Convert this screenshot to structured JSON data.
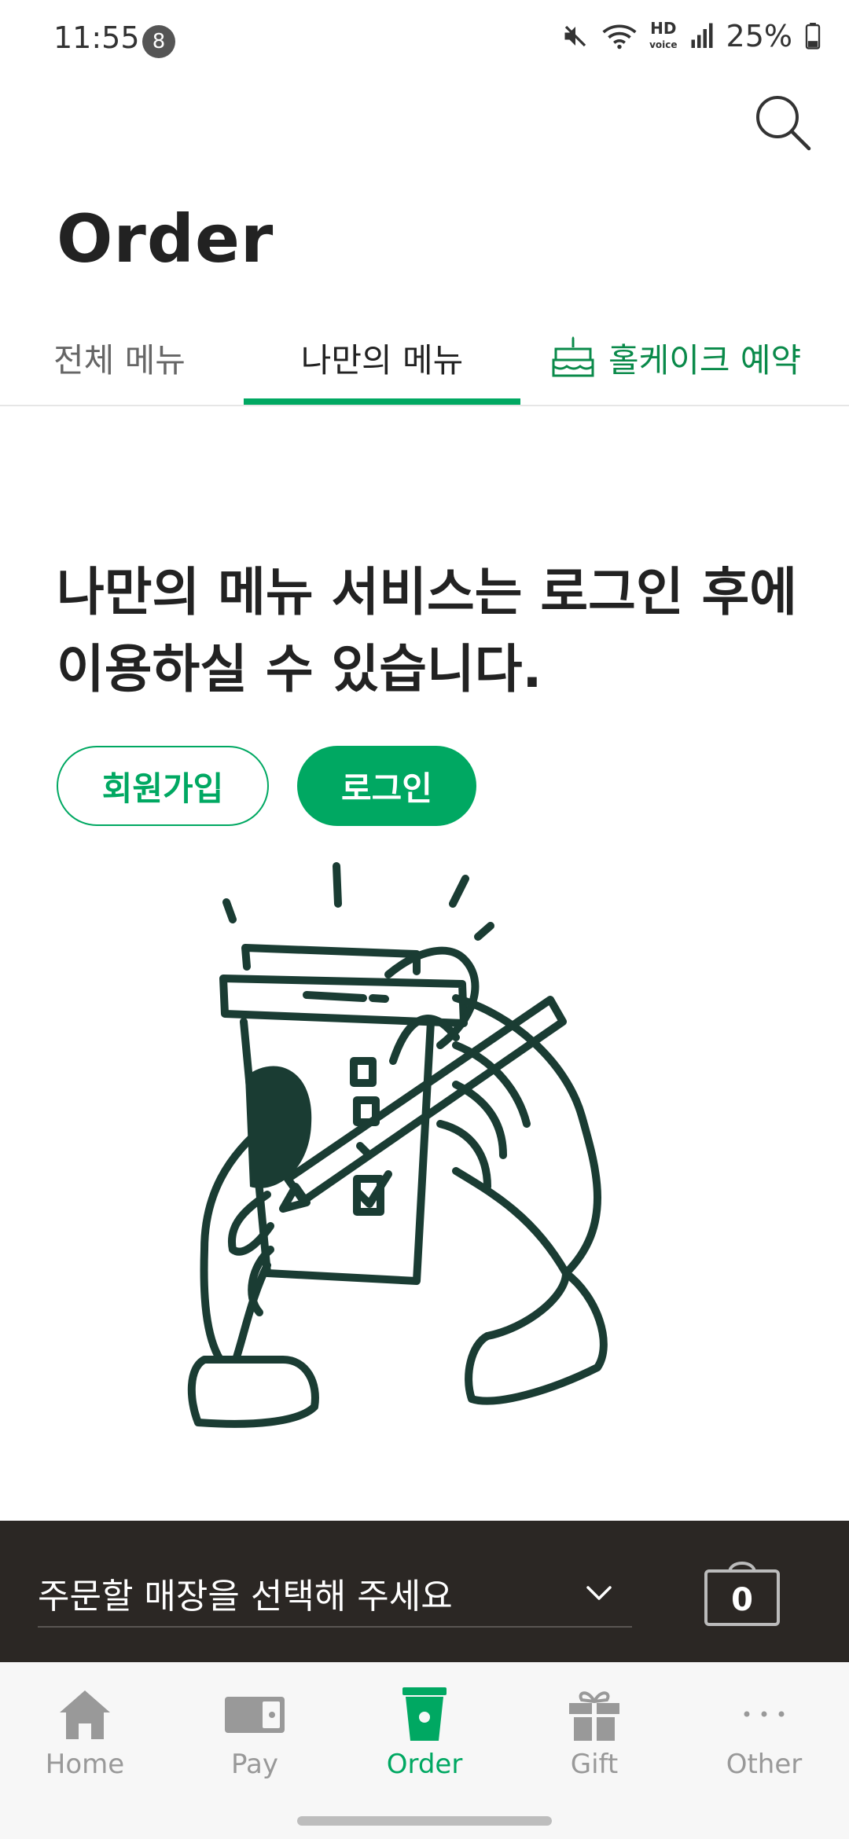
{
  "status_bar": {
    "time": "11:55",
    "notification_count": "8",
    "hd_label": "HD",
    "battery": "25%"
  },
  "header": {
    "title": "Order"
  },
  "tabs": [
    {
      "label": "전체 메뉴"
    },
    {
      "label": "나만의 메뉴"
    },
    {
      "label": "홀케이크 예약"
    }
  ],
  "main": {
    "message_line1": "나만의 메뉴 서비스는 로그인 후에",
    "message_line2": "이용하실 수 있습니다.",
    "join_button": "회원가입",
    "login_button": "로그인"
  },
  "store_bar": {
    "select_label": "주문할 매장을 선택해 주세요",
    "cart_count": "0"
  },
  "bottom_nav": [
    {
      "label": "Home"
    },
    {
      "label": "Pay"
    },
    {
      "label": "Order"
    },
    {
      "label": "Gift"
    },
    {
      "label": "Other"
    }
  ],
  "colors": {
    "accent": "#00a862",
    "dark_bar": "#2b2724",
    "illustration": "#1a3c33"
  }
}
